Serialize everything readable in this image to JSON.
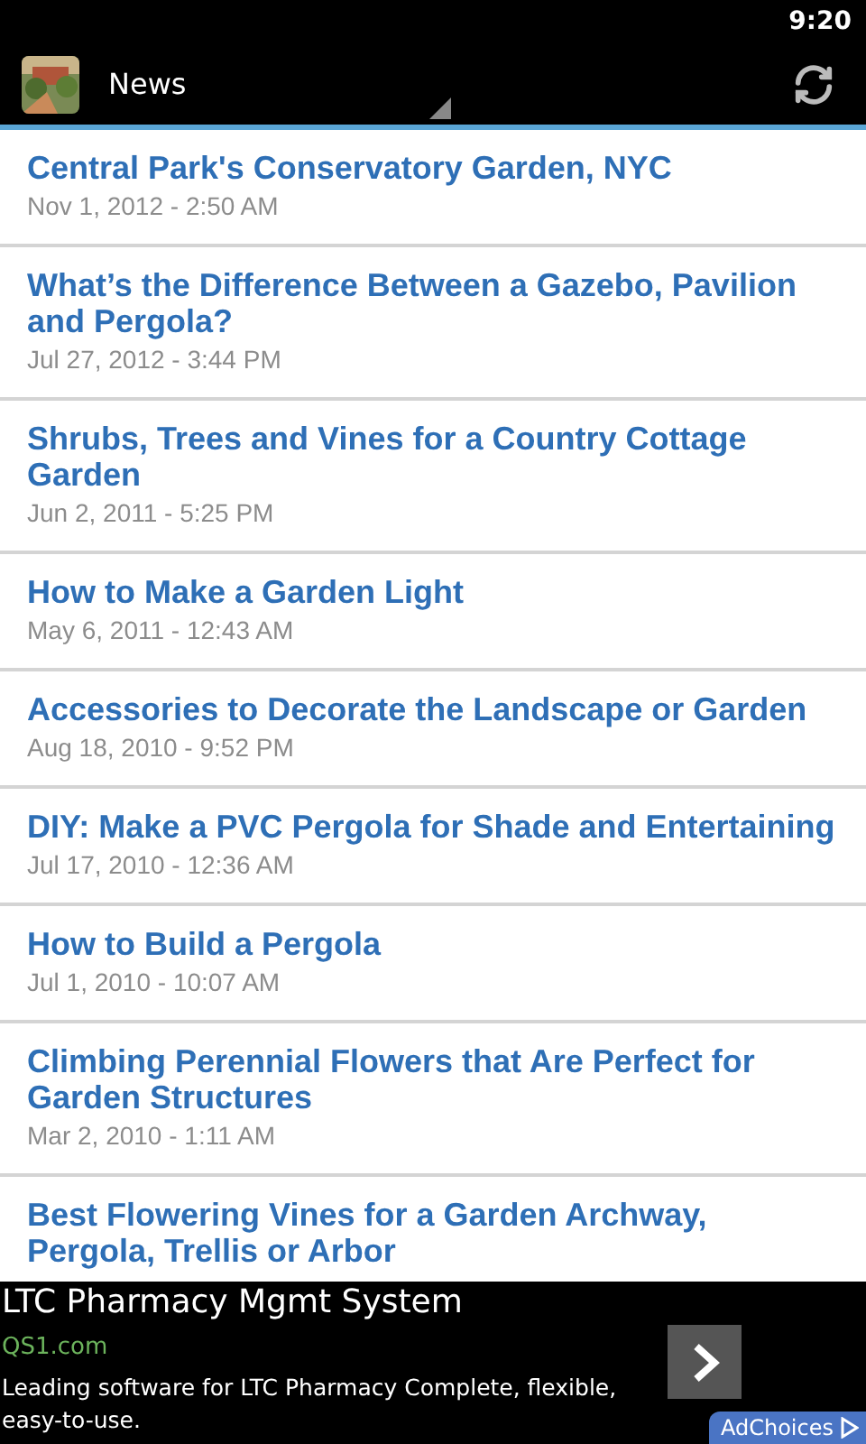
{
  "status_bar": {
    "time": "9:20"
  },
  "action_bar": {
    "title": "News"
  },
  "articles": [
    {
      "title": "Central Park's Conservatory Garden, NYC",
      "date": "Nov 1, 2012 - 2:50 AM"
    },
    {
      "title": "What’s the Difference Between a Gazebo, Pavilion and Pergola?",
      "date": "Jul 27, 2012 - 3:44 PM"
    },
    {
      "title": "Shrubs, Trees and Vines for a Country Cottage Garden",
      "date": "Jun 2, 2011 - 5:25 PM"
    },
    {
      "title": "How to Make a Garden Light",
      "date": "May 6, 2011 - 12:43 AM"
    },
    {
      "title": "Accessories to Decorate the Landscape or Garden",
      "date": "Aug 18, 2010 - 9:52 PM"
    },
    {
      "title": "DIY: Make a PVC Pergola for Shade and Entertaining",
      "date": "Jul 17, 2010 - 12:36 AM"
    },
    {
      "title": "How to Build a Pergola",
      "date": "Jul 1, 2010 - 10:07 AM"
    },
    {
      "title": "Climbing Perennial Flowers that Are Perfect for Garden Structures",
      "date": "Mar 2, 2010 - 1:11 AM"
    },
    {
      "title": "Best Flowering Vines for a Garden Archway, Pergola, Trellis or Arbor"
    }
  ],
  "ad": {
    "headline": "LTC Pharmacy Mgmt System",
    "url": "QS1.com",
    "text": "Leading software for LTC Pharmacy Complete, flexible, easy-to-use.",
    "badge": "AdChoices"
  }
}
